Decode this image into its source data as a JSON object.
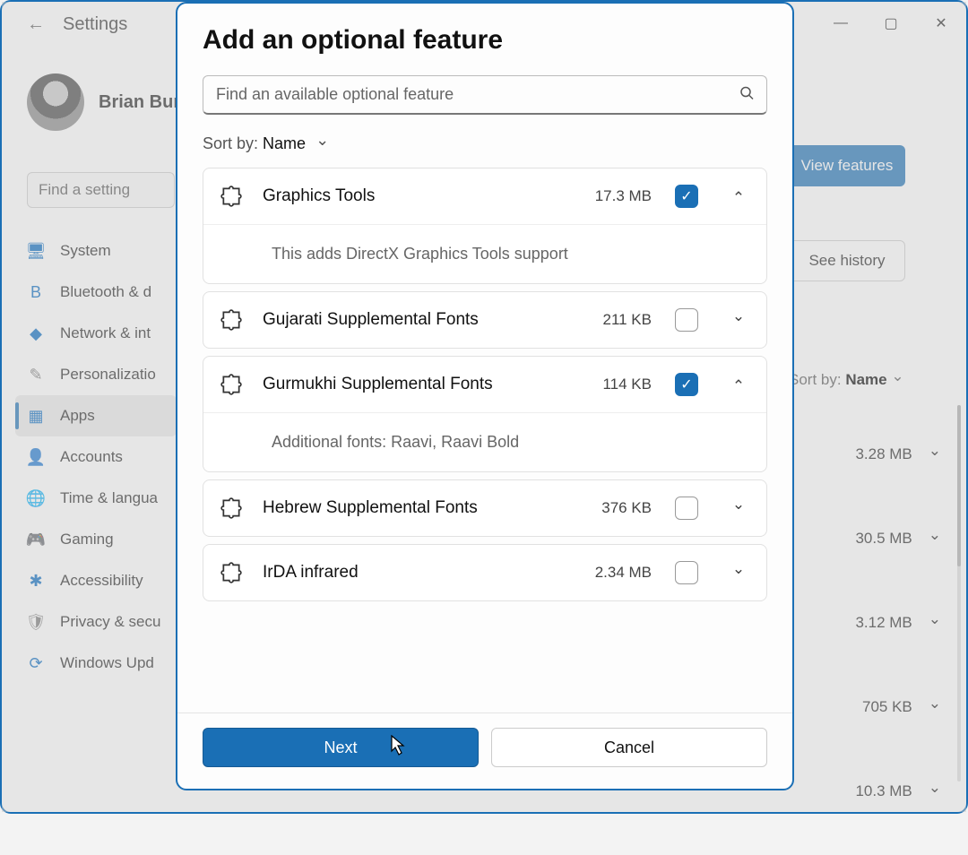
{
  "window": {
    "back_label": "←",
    "title": "Settings",
    "buttons": {
      "min": "—",
      "max": "▢",
      "close": "✕"
    }
  },
  "user": {
    "name": "Brian Bur"
  },
  "find_setting_placeholder": "Find a setting",
  "sidebar": {
    "items": [
      {
        "label": "System",
        "icon": "🖥",
        "color": "#0067c0"
      },
      {
        "label": "Bluetooth & d",
        "icon": "B",
        "color": "#0067c0"
      },
      {
        "label": "Network & int",
        "icon": "◆",
        "color": "#0067c0"
      },
      {
        "label": "Personalizatio",
        "icon": "✎",
        "color": "#777"
      },
      {
        "label": "Apps",
        "icon": "▦",
        "color": "#0067c0"
      },
      {
        "label": "Accounts",
        "icon": "👤",
        "color": "#0067c0"
      },
      {
        "label": "Time & langua",
        "icon": "🌐",
        "color": "#0067c0"
      },
      {
        "label": "Gaming",
        "icon": "🎮",
        "color": "#777"
      },
      {
        "label": "Accessibility",
        "icon": "✱",
        "color": "#0067c0"
      },
      {
        "label": "Privacy & secu",
        "icon": "🛡",
        "color": "#777"
      },
      {
        "label": "Windows Upd",
        "icon": "⟳",
        "color": "#0067c0"
      }
    ],
    "selected_index": 4
  },
  "right_panel": {
    "view_features": "View features",
    "see_history": "See history",
    "sort_label": "Sort by:",
    "sort_value": "Name",
    "rows": [
      {
        "size": "3.28 MB"
      },
      {
        "size": "30.5 MB"
      },
      {
        "size": "3.12 MB"
      },
      {
        "size": "705 KB"
      },
      {
        "size": "10.3 MB"
      }
    ]
  },
  "modal": {
    "title": "Add an optional feature",
    "search_placeholder": "Find an available optional feature",
    "sort_label": "Sort by:",
    "sort_value": "Name",
    "features": [
      {
        "name": "Graphics Tools",
        "size": "17.3 MB",
        "checked": true,
        "expanded": true,
        "desc": "This adds DirectX Graphics Tools support"
      },
      {
        "name": "Gujarati Supplemental Fonts",
        "size": "211 KB",
        "checked": false,
        "expanded": false,
        "desc": ""
      },
      {
        "name": "Gurmukhi Supplemental Fonts",
        "size": "114 KB",
        "checked": true,
        "expanded": true,
        "desc": "Additional fonts: Raavi, Raavi Bold"
      },
      {
        "name": "Hebrew Supplemental Fonts",
        "size": "376 KB",
        "checked": false,
        "expanded": false,
        "desc": ""
      },
      {
        "name": "IrDA infrared",
        "size": "2.34 MB",
        "checked": false,
        "expanded": false,
        "desc": ""
      }
    ],
    "next": "Next",
    "cancel": "Cancel"
  }
}
